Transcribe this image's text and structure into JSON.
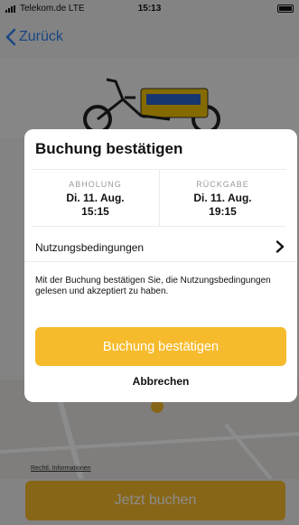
{
  "status_bar": {
    "carrier": "Telekom.de  LTE",
    "time": "15:13"
  },
  "nav": {
    "back_label": "Zurück",
    "back_icon": "chevron-left-icon"
  },
  "bike_banner": {
    "icon": "cargo-bike-image"
  },
  "map": {
    "legal_link": "Rechtl. Informationen",
    "marker_icon": "map-pin-icon"
  },
  "bottom": {
    "book_label": "Jetzt buchen"
  },
  "dialog": {
    "title": "Buchung bestätigen",
    "pickup": {
      "label": "ABHOLUNG",
      "date": "Di. 11. Aug.",
      "time": "15:15"
    },
    "return": {
      "label": "RÜCKGABE",
      "date": "Di. 11. Aug.",
      "time": "19:15"
    },
    "terms_label": "Nutzungsbedingungen",
    "terms_icon": "chevron-right-icon",
    "note": "Mit der Buchung bestätigen Sie, die Nutzungsbedingungen gelesen und akzeptiert zu haben.",
    "confirm_label": "Buchung bestätigen",
    "cancel_label": "Abbrechen"
  },
  "colors": {
    "accent": "#f6bb2c",
    "link": "#2f80ed"
  }
}
